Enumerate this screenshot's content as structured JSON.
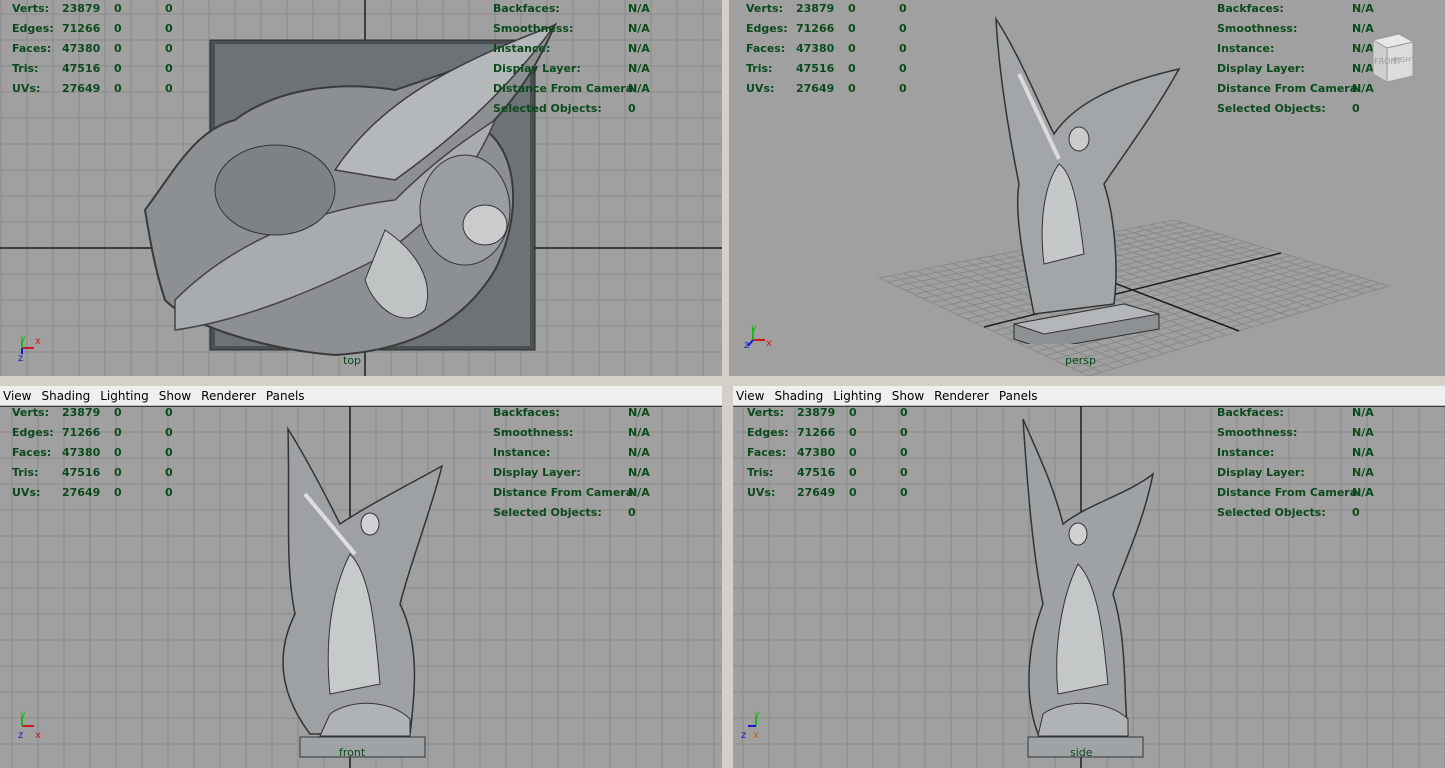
{
  "menu": [
    "View",
    "Shading",
    "Lighting",
    "Show",
    "Renderer",
    "Panels"
  ],
  "hud_left": [
    {
      "label": "Verts:",
      "v1": "23879",
      "v2": "0",
      "v3": "0"
    },
    {
      "label": "Edges:",
      "v1": "71266",
      "v2": "0",
      "v3": "0"
    },
    {
      "label": "Faces:",
      "v1": "47380",
      "v2": "0",
      "v3": "0"
    },
    {
      "label": "Tris:",
      "v1": "47516",
      "v2": "0",
      "v3": "0"
    },
    {
      "label": "UVs:",
      "v1": "27649",
      "v2": "0",
      "v3": "0"
    }
  ],
  "hud_right": [
    {
      "label": "Backfaces:",
      "v": "N/A"
    },
    {
      "label": "Smoothness:",
      "v": "N/A"
    },
    {
      "label": "Instance:",
      "v": "N/A"
    },
    {
      "label": "Display Layer:",
      "v": "N/A"
    },
    {
      "label": "Distance From Camera:",
      "v": "N/A"
    },
    {
      "label": "Selected Objects:",
      "v": "0"
    }
  ],
  "viewports": {
    "top": {
      "label": "top"
    },
    "persp": {
      "label": "persp"
    },
    "front": {
      "label": "front"
    },
    "side": {
      "label": "side"
    }
  },
  "viewcube": {
    "front": "FRONT",
    "right": "RIGHT"
  },
  "axes": {
    "x": "x",
    "y": "y",
    "z": "z"
  },
  "colors": {
    "viewport_bg": "#a0a0a0",
    "grid_line": "#8a8a8a",
    "grid_axis": "#1c1c1c",
    "hud_text": "#0b4a1b",
    "axis_x": "#d01818",
    "axis_y": "#18b818",
    "axis_z": "#1818d0"
  }
}
